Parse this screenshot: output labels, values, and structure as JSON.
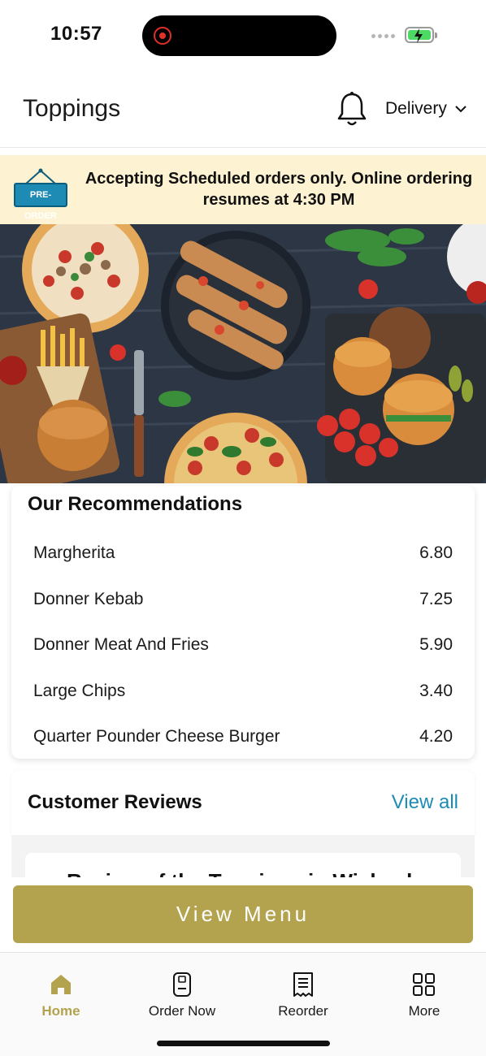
{
  "status": {
    "time": "10:57"
  },
  "header": {
    "title": "Toppings",
    "bell_icon": "bell-icon",
    "mode": "Delivery"
  },
  "notice": {
    "badge": "PRE-ORDER",
    "text": "Accepting Scheduled orders only. Online ordering resumes at 4:30 PM",
    "bg_color": "#fdf3d2"
  },
  "recommendations": {
    "title": "Our Recommendations",
    "items": [
      {
        "name": "Margherita",
        "price": "6.80"
      },
      {
        "name": "Donner Kebab",
        "price": "7.25"
      },
      {
        "name": "Donner Meat And Fries",
        "price": "5.90"
      },
      {
        "name": "Large Chips",
        "price": "3.40"
      },
      {
        "name": "Quarter Pounder Cheese Burger",
        "price": "4.20"
      }
    ]
  },
  "reviews": {
    "title": "Customer Reviews",
    "view_all": "View all",
    "preview": "Review of the Toppings in Wisbech"
  },
  "cta": {
    "label": "View Menu",
    "color": "#b3a24e"
  },
  "tabbar": {
    "items": [
      {
        "label": "Home",
        "icon": "home-icon",
        "active": true
      },
      {
        "label": "Order Now",
        "icon": "phone-order-icon",
        "active": false
      },
      {
        "label": "Reorder",
        "icon": "receipt-icon",
        "active": false
      },
      {
        "label": "More",
        "icon": "grid-icon",
        "active": false
      }
    ]
  },
  "colors": {
    "accent": "#b3a24e",
    "link": "#1e8bb4"
  }
}
